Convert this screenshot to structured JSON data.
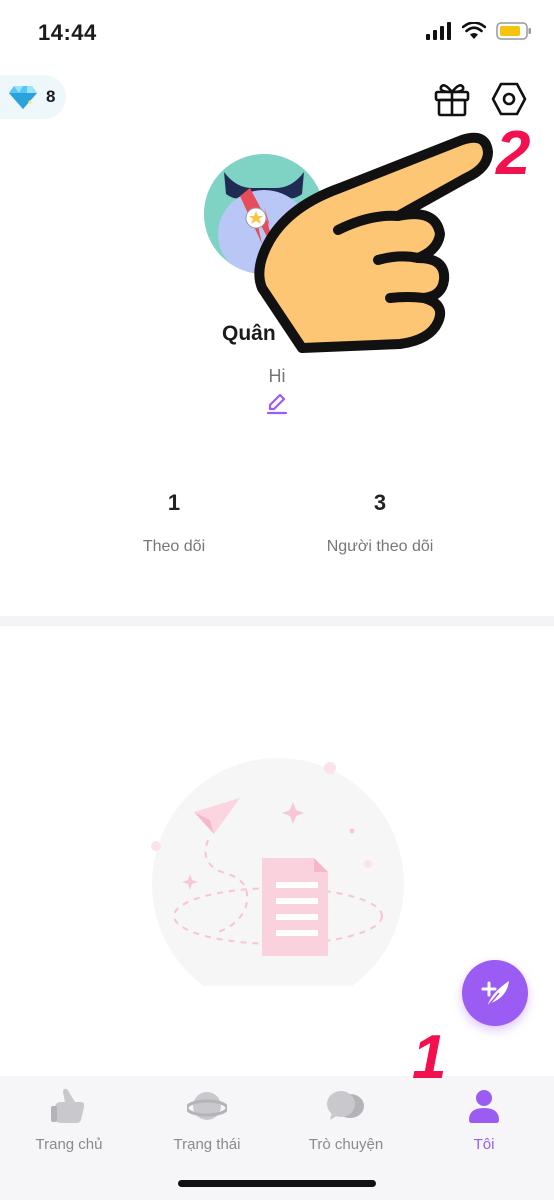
{
  "status_bar": {
    "time": "14:44",
    "icons": [
      "signal-icon",
      "wifi-icon",
      "battery-icon"
    ]
  },
  "diamond": {
    "icon": "diamond-icon",
    "count": "8"
  },
  "header_actions": {
    "gift_icon": "gift-icon",
    "settings_icon": "settings-icon"
  },
  "profile": {
    "name": "Quân",
    "bio": "Hi",
    "edit_icon": "edit-icon"
  },
  "stats": {
    "following": {
      "value": "1",
      "label": "Theo dõi"
    },
    "followers": {
      "value": "3",
      "label": "Người theo dõi"
    }
  },
  "fab": {
    "icon": "compose-icon"
  },
  "nav": {
    "items": [
      {
        "label": "Trang chủ",
        "icon": "home-hand-icon",
        "active": false
      },
      {
        "label": "Trạng thái",
        "icon": "planet-icon",
        "active": false
      },
      {
        "label": "Trò chuyện",
        "icon": "chat-icon",
        "active": false
      },
      {
        "label": "Tôi",
        "icon": "profile-icon",
        "active": true
      }
    ]
  },
  "annotations": {
    "step1": "1",
    "step2": "2"
  },
  "colors": {
    "accent": "#9a5cf2",
    "annotation": "#f2114e",
    "hand": "#fcc675"
  }
}
